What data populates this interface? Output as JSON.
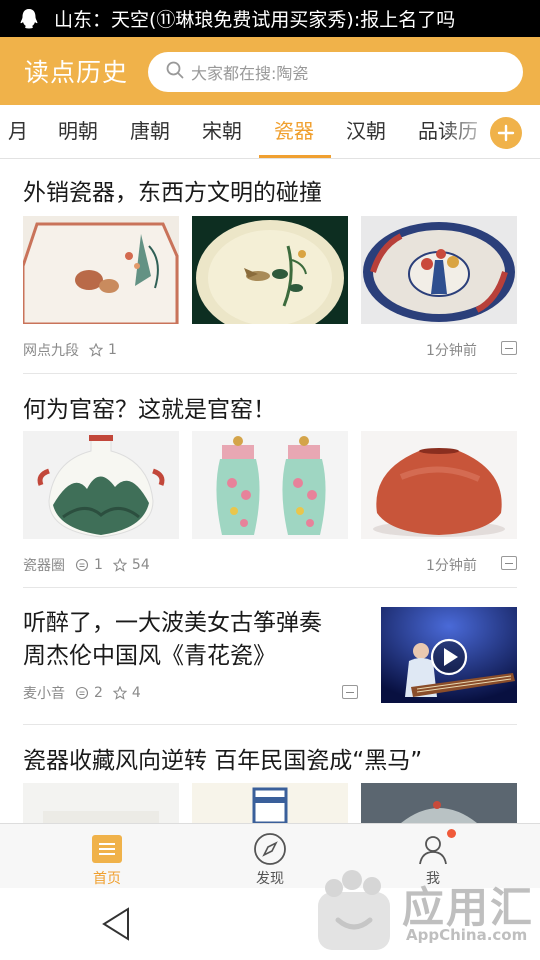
{
  "status_bar": {
    "notification": "山东：天空(⑪琳琅免费试用买家秀):报上名了吗"
  },
  "header": {
    "logo": "读点历史",
    "search_placeholder": "大家都在搜:陶瓷"
  },
  "tabs": {
    "items": [
      "月",
      "明朝",
      "唐朝",
      "宋朝",
      "瓷器",
      "汉朝",
      "品读历"
    ],
    "active": "瓷器",
    "add_label": "+"
  },
  "colors": {
    "accent": "#f0b24a",
    "active_tab": "#f0a030"
  },
  "articles": [
    {
      "title": "外销瓷器，东西方文明的碰撞",
      "source": "网点九段",
      "stars": "1",
      "time": "1分钟前",
      "images": [
        "octagonal-famille-plate",
        "cream-dish-bird-flowers",
        "imari-blue-red-charger"
      ]
    },
    {
      "title": "何为官窑？这就是官窑！",
      "source": "瓷器圈",
      "comments": "1",
      "stars": "54",
      "time": "1分钟前",
      "images": [
        "landscape-moon-flask",
        "pair-famille-rose-jars",
        "red-glazed-water-pot"
      ]
    },
    {
      "title_line1": "听醉了，一大波美女古筝弹奏",
      "title_line2": "周杰伦中国风《青花瓷》",
      "source": "麦小音",
      "comments": "2",
      "stars": "4",
      "image": "guzheng-performance-video"
    },
    {
      "title": "瓷器收藏风向逆转 百年民国瓷成“黑马”",
      "images": [
        "white-porcelain",
        "blue-white-vase",
        "famille-vase"
      ]
    }
  ],
  "bottom_nav": {
    "items": [
      {
        "label": "首页",
        "icon": "home-list-icon",
        "active": true
      },
      {
        "label": "发现",
        "icon": "compass-icon",
        "active": false
      },
      {
        "label": "我",
        "icon": "user-icon",
        "active": false
      }
    ]
  },
  "watermark": {
    "cn": "应用汇",
    "en": "AppChina.com"
  }
}
